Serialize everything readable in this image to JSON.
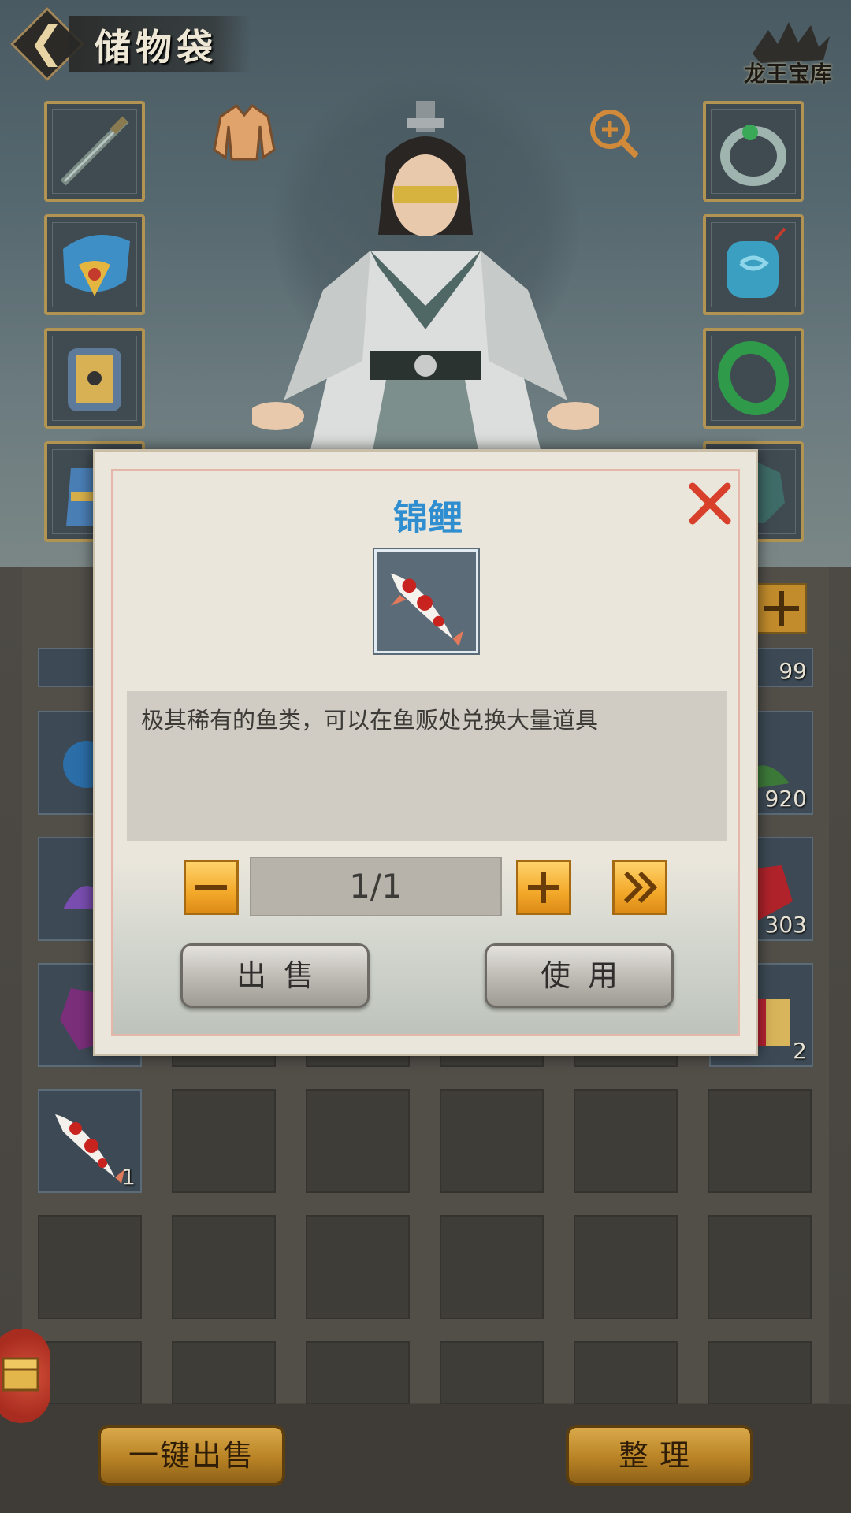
{
  "header": {
    "title": "储物袋",
    "brand_logo_text": "龙王宝库"
  },
  "equipment": {
    "left_slots": [
      "sword-icon",
      "helmet-icon",
      "armor-icon",
      "boots-icon"
    ],
    "right_slots": [
      "ring-icon",
      "jade-pendant-icon",
      "jade-bracelet-icon",
      "jade-amulet-icon"
    ],
    "fashion_icon": "robe-icon",
    "zoom_icon": "zoom-in-icon"
  },
  "inventory": {
    "row1_counts": [
      "",
      "",
      "",
      "",
      "",
      "99"
    ],
    "row2_counts": [
      "",
      "",
      "",
      "",
      "",
      "920"
    ],
    "row3_counts": [
      "",
      "",
      "",
      "",
      "",
      "303"
    ],
    "row4_counts": [
      "",
      "",
      "",
      "",
      "",
      "2"
    ],
    "fish_count": "1"
  },
  "dialog": {
    "item_name": "锦鲤",
    "description": "极其稀有的鱼类，可以在鱼贩处兑换大量道具",
    "quantity": "1/1",
    "sell_label": "出售",
    "use_label": "使用"
  },
  "bottom": {
    "sell_all_label": "一键出售",
    "sort_label": "整理"
  },
  "colors": {
    "title_blue": "#2e8ed0",
    "gold_button": "#d9a94a",
    "close_red": "#d8402c"
  }
}
